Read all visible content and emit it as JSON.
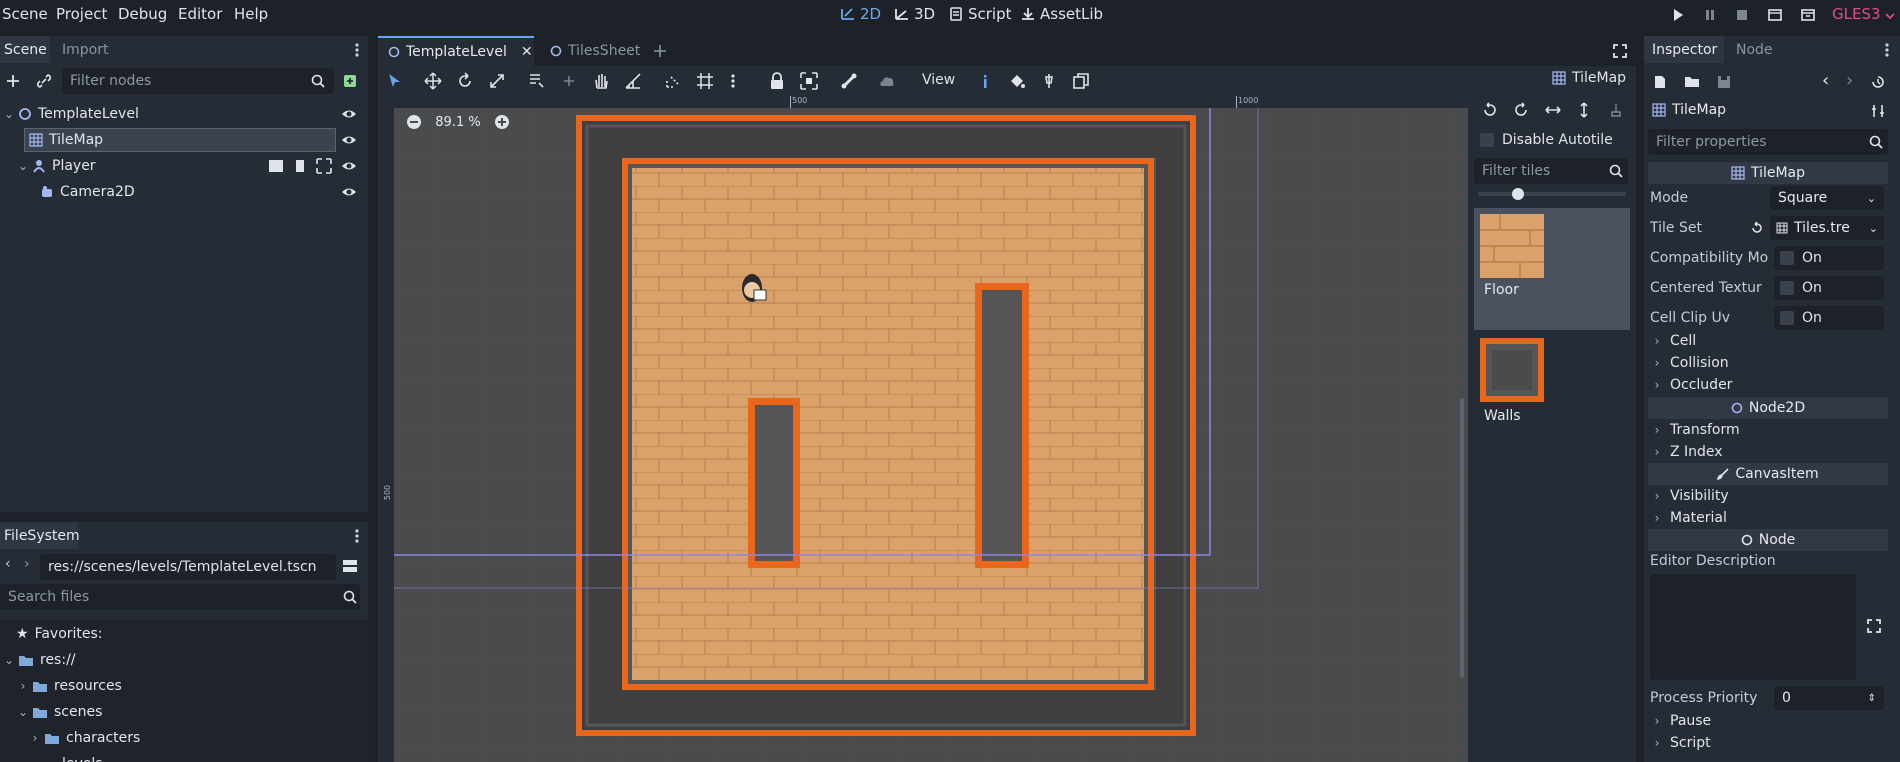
{
  "menu": [
    "Scene",
    "Project",
    "Debug",
    "Editor",
    "Help"
  ],
  "workspaces": [
    {
      "label": "2D",
      "icon": "2d-icon",
      "active": true
    },
    {
      "label": "3D",
      "icon": "3d-icon",
      "active": false
    },
    {
      "label": "Script",
      "icon": "script-icon",
      "active": false
    },
    {
      "label": "AssetLib",
      "icon": "assetlib-icon",
      "active": false
    }
  ],
  "renderer": "GLES3",
  "scene_dock": {
    "tabs": [
      "Scene",
      "Import"
    ],
    "filter_placeholder": "Filter nodes",
    "tree": [
      {
        "label": "TemplateLevel",
        "icon": "node2d-icon"
      },
      {
        "label": "TileMap",
        "icon": "tilemap-icon",
        "selected": true
      },
      {
        "label": "Player",
        "icon": "player-icon"
      },
      {
        "label": "Camera2D",
        "icon": "camera-icon"
      }
    ]
  },
  "filesystem": {
    "title": "FileSystem",
    "path": "res://scenes/levels/TemplateLevel.tscn",
    "search_placeholder": "Search files",
    "tree": [
      {
        "label": "Favorites:",
        "icon": "star-icon"
      },
      {
        "label": "res://",
        "icon": "folder-icon"
      },
      {
        "label": "resources",
        "icon": "folder-icon"
      },
      {
        "label": "scenes",
        "icon": "folder-icon"
      },
      {
        "label": "characters",
        "icon": "folder-icon"
      },
      {
        "label": "levels",
        "icon": "folder-icon"
      }
    ]
  },
  "editor_tabs": [
    "TemplateLevel",
    "TilesSheet"
  ],
  "toolbar": {
    "view_label": "View",
    "tilemap_label": "TileMap"
  },
  "zoom": "89.1 %",
  "ruler": {
    "mark_500": "500",
    "mark_1000": "1000",
    "vmark_500": "500"
  },
  "tile_palette": {
    "disable_autotile": "Disable Autotile",
    "filter_placeholder": "Filter tiles",
    "tiles": [
      "Floor",
      "Walls"
    ]
  },
  "inspector": {
    "tabs": [
      "Inspector",
      "Node"
    ],
    "object": "TileMap",
    "filter_placeholder": "Filter properties",
    "class_header": "TileMap",
    "mode_label": "Mode",
    "mode_value": "Square",
    "tileset_label": "Tile Set",
    "tileset_value": "Tiles.tre",
    "compat_label": "Compatibility Mo",
    "centered_label": "Centered Textur",
    "clipuv_label": "Cell Clip Uv",
    "on_text": "On",
    "sections_tilemap": [
      "Cell",
      "Collision",
      "Occluder"
    ],
    "node2d_header": "Node2D",
    "sections_node2d": [
      "Transform",
      "Z Index"
    ],
    "canvasitem_header": "CanvasItem",
    "sections_canvas": [
      "Visibility",
      "Material"
    ],
    "node_header": "Node",
    "editor_description": "Editor Description",
    "process_priority_label": "Process Priority",
    "process_priority_value": "0",
    "sections_node": [
      "Pause",
      "Script"
    ]
  },
  "colors": {
    "accent": "#6aa6ee",
    "wall": "#e8671c",
    "floor": "#daa26a",
    "renderer": "#e24c86"
  }
}
